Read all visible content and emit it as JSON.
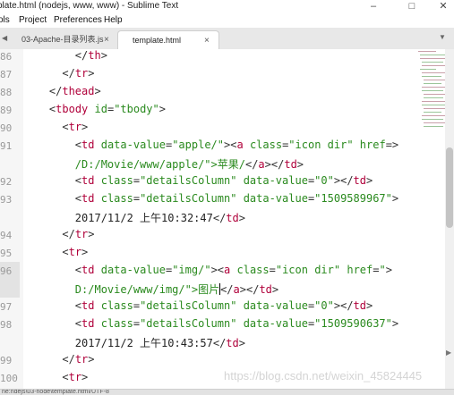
{
  "window": {
    "title": "plate.html (nodejs, www, www) - Sublime Text",
    "minimize": "–",
    "maximize": "□",
    "close": "✕"
  },
  "menu": [
    "ols",
    "Project",
    "Preferences",
    "Help"
  ],
  "tabs": [
    {
      "label": "03-Apache-目录列表.js",
      "active": false
    },
    {
      "label": "template.html",
      "active": true
    }
  ],
  "tab_close": "×",
  "tab_left_arrow": "◀",
  "tab_right_arrow": "▶",
  "tab_overflow_arrow": "▼",
  "line_numbers": [
    "86",
    "87",
    "88",
    "89",
    "90",
    "91",
    "",
    "92",
    "93",
    "",
    "94",
    "95",
    "96",
    "",
    "97",
    "98",
    "",
    "99",
    "100"
  ],
  "code_lines": [
    "        </th>",
    "      </tr>",
    "    </thead>",
    "    <tbody id=\"tbody\">",
    "      <tr>",
    "        <td data-value=\"apple/\"><a class=\"icon dir\" href=\"",
    "        /D:/Movie/www/apple/\">苹果/</a></td>",
    "        <td class=\"detailsColumn\" data-value=\"0\"></td>",
    "        <td class=\"detailsColumn\" data-value=\"1509589967\">",
    "        2017/11/2 上午10:32:47</td>",
    "      </tr>",
    "      <tr>",
    "        <td data-value=\"img/\"><a class=\"icon dir\" href=\"/",
    "        D:/Movie/www/img/\">图片</a></td>",
    "        <td class=\"detailsColumn\" data-value=\"0\"></td>",
    "        <td class=\"detailsColumn\" data-value=\"1509590637\">",
    "        2017/11/2 上午10:43:57</td>",
    "      </tr>",
    "      <tr>"
  ],
  "watermark": "https://blog.csdn.net/weixin_45824445",
  "status": "ne:ndejs\\03-node\\template.html/UTF-8"
}
